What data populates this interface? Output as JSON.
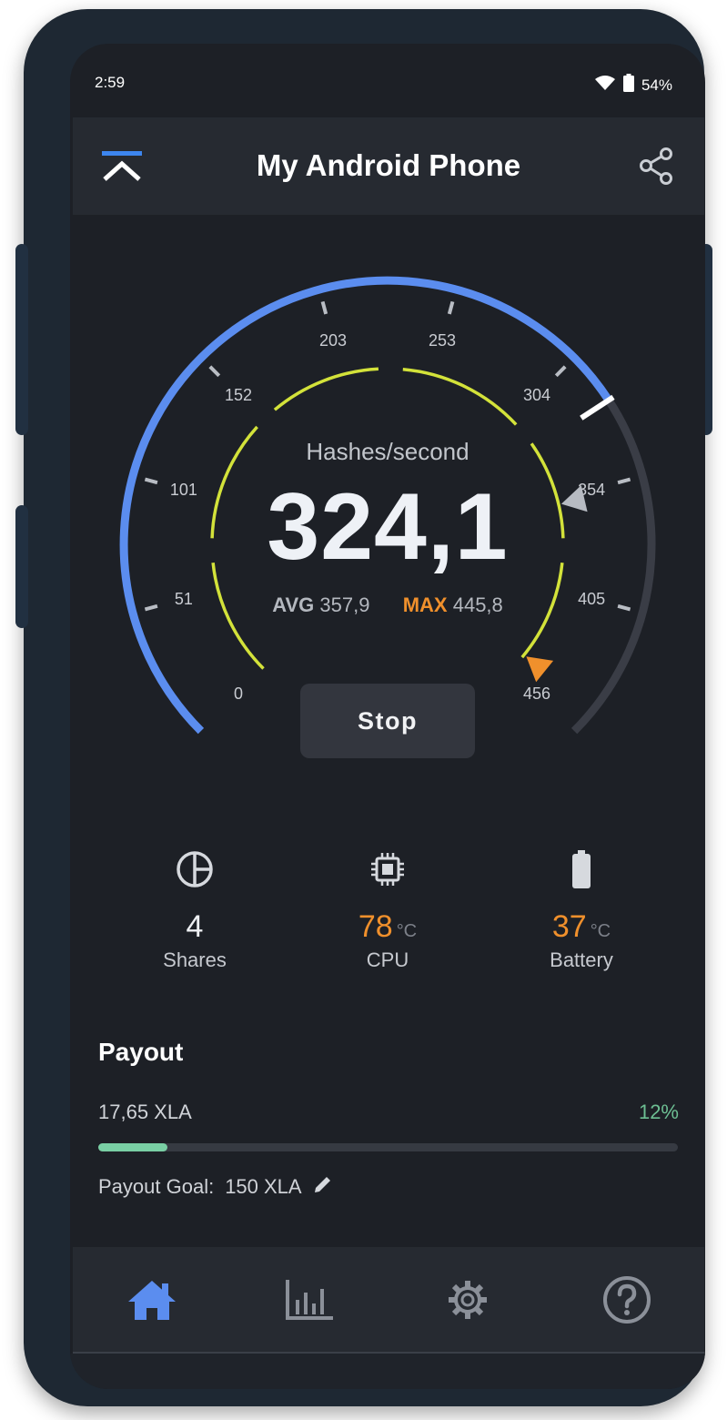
{
  "status_bar": {
    "time": "2:59",
    "battery": "54%"
  },
  "app_bar": {
    "title": "My Android Phone"
  },
  "gauge": {
    "label": "Hashes/second",
    "value": "324,1",
    "current_value": 324.1,
    "scale_min": 0,
    "scale_max": 456,
    "ticks": [
      "0",
      "51",
      "101",
      "152",
      "203",
      "253",
      "304",
      "354",
      "405",
      "456"
    ],
    "avg_label": "AVG",
    "avg_value": "357,9",
    "max_label": "MAX",
    "max_value": "445,8",
    "accent_color": "#5b8def",
    "ring_color": "#d3e23a",
    "max_color": "#f0902c"
  },
  "stop_button": {
    "label": "Stop"
  },
  "stats": {
    "shares": {
      "icon": "pie-chart-icon",
      "value": "4",
      "label": "Shares"
    },
    "cpu": {
      "icon": "cpu-chip-icon",
      "value": "78",
      "unit": "°C",
      "label": "CPU"
    },
    "battery": {
      "icon": "battery-icon",
      "value": "37",
      "unit": "°C",
      "label": "Battery"
    }
  },
  "payout": {
    "title": "Payout",
    "amount": "17,65 XLA",
    "percent": "12%",
    "progress": 0.12,
    "goal_label": "Payout Goal:",
    "goal_value": "150 XLA"
  },
  "bottom_nav": {
    "items": [
      {
        "icon": "home-icon",
        "active": true
      },
      {
        "icon": "bar-chart-icon",
        "active": false
      },
      {
        "icon": "gear-icon",
        "active": false
      },
      {
        "icon": "help-icon",
        "active": false
      }
    ],
    "active_color": "#5b8def",
    "inactive_color": "#8b9099"
  }
}
